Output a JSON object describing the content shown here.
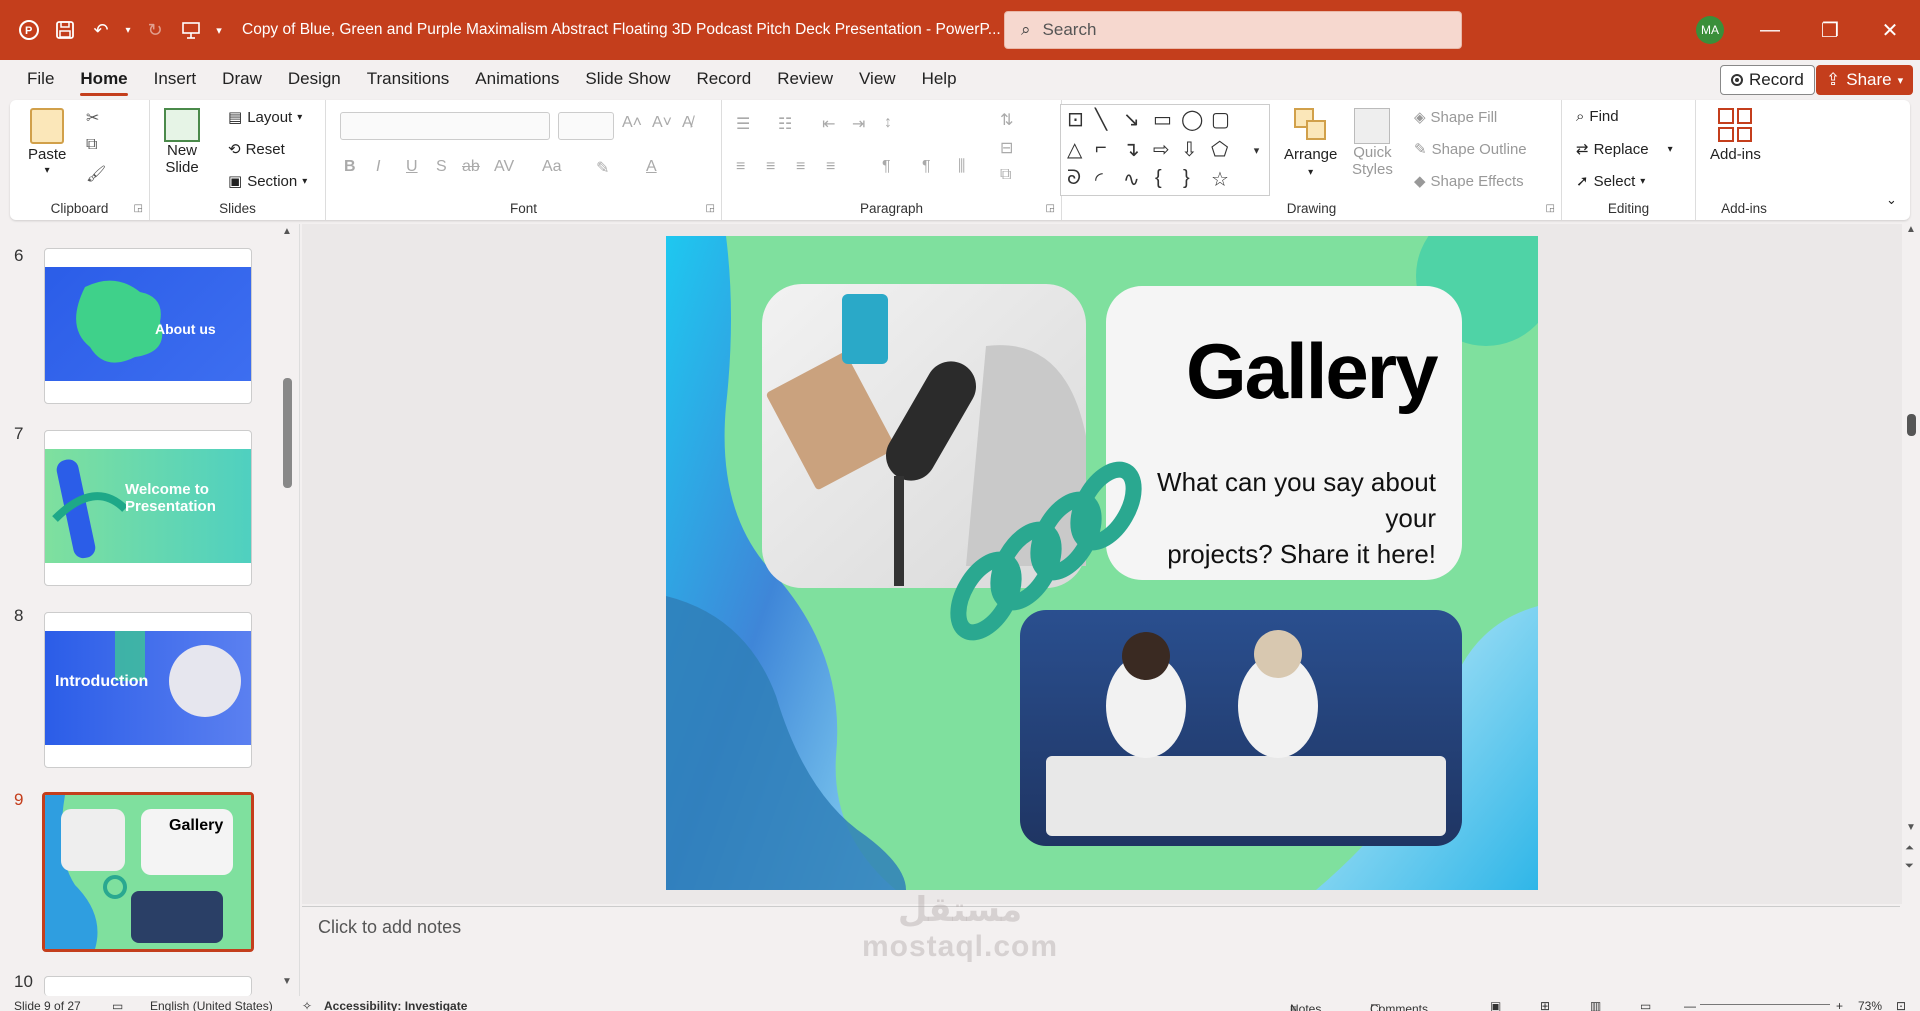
{
  "app": {
    "title": "Copy of Blue, Green and Purple Maximalism Abstract Floating 3D Podcast Pitch Deck Presentation  -  PowerP...",
    "search_placeholder": "Search",
    "avatar_initials": "MA",
    "accent": "#c43e1c"
  },
  "tabs": [
    "File",
    "Home",
    "Insert",
    "Draw",
    "Design",
    "Transitions",
    "Animations",
    "Slide Show",
    "Record",
    "Review",
    "View",
    "Help"
  ],
  "active_tab": "Home",
  "record_label": "Record",
  "share_label": "Share",
  "ribbon": {
    "clipboard": {
      "label": "Clipboard",
      "paste": "Paste"
    },
    "slides": {
      "label": "Slides",
      "new_slide": "New",
      "new_slide2": "Slide",
      "layout": "Layout",
      "reset": "Reset",
      "section": "Section"
    },
    "font": {
      "label": "Font"
    },
    "paragraph": {
      "label": "Paragraph"
    },
    "drawing": {
      "label": "Drawing",
      "arrange": "Arrange",
      "quick_styles": "Quick",
      "quick_styles2": "Styles",
      "shape_fill": "Shape Fill",
      "shape_outline": "Shape Outline",
      "shape_effects": "Shape Effects"
    },
    "editing": {
      "label": "Editing",
      "find": "Find",
      "replace": "Replace",
      "select": "Select"
    },
    "addins": {
      "label": "Add-ins",
      "button": "Add-ins"
    }
  },
  "thumbnails": [
    {
      "num": "6",
      "title": "About us",
      "colors": [
        "#2b5de8",
        "#3d6ef0"
      ]
    },
    {
      "num": "7",
      "title": "Welcome to Presentation",
      "colors": [
        "#7fe09e",
        "#4fd0c0"
      ]
    },
    {
      "num": "8",
      "title": "Introduction",
      "colors": [
        "#2b5de8",
        "#5b80f0"
      ]
    },
    {
      "num": "9",
      "title": "Gallery",
      "colors": [
        "#7fe09e",
        "#34b8e0"
      ]
    },
    {
      "num": "10",
      "title": "",
      "colors": [
        "#ffffff",
        "#ffffff"
      ]
    }
  ],
  "selected_slide": "9",
  "slide": {
    "title": "Gallery",
    "body_line1": "What can you say about your",
    "body_line2": "projects? Share it here!"
  },
  "notes_placeholder": "Click to add notes",
  "status": {
    "slide_of": "Slide 9 of 27",
    "language": "English (United States)",
    "accessibility": "Accessibility: Investigate",
    "notes": "Notes",
    "comments": "Comments",
    "zoom": "73%"
  },
  "watermark": {
    "line1": "مستقل",
    "line2": "mostaql.com"
  }
}
